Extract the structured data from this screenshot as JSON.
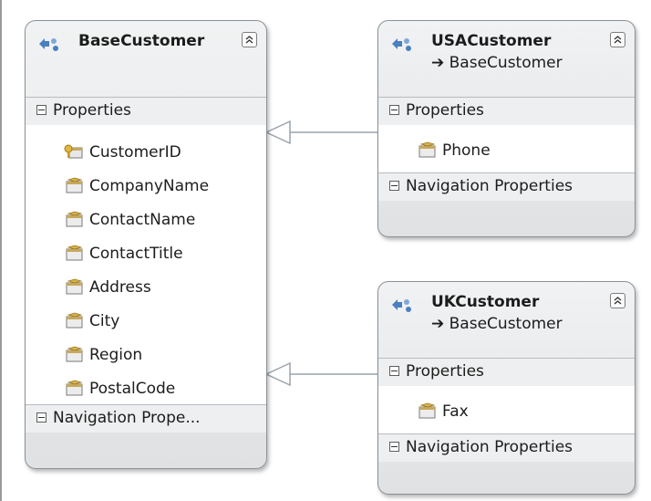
{
  "entities": {
    "base_customer": {
      "name": "BaseCustomer",
      "sections": {
        "properties": "Properties",
        "navigation": "Navigation  Prope..."
      },
      "properties": [
        "CustomerID",
        "CompanyName",
        "ContactName",
        "ContactTitle",
        "Address",
        "City",
        "Region",
        "PostalCode"
      ],
      "property_icons": [
        "key-property-icon",
        "property-icon",
        "property-icon",
        "property-icon",
        "property-icon",
        "property-icon",
        "property-icon",
        "property-icon"
      ]
    },
    "usa_customer": {
      "name": "USACustomer",
      "base": "➔ BaseCustomer",
      "sections": {
        "properties": "Properties",
        "navigation": "Navigation Properties"
      },
      "properties": [
        "Phone"
      ],
      "property_icons": [
        "property-icon"
      ]
    },
    "uk_customer": {
      "name": "UKCustomer",
      "base": "➔ BaseCustomer",
      "sections": {
        "properties": "Properties",
        "navigation": "Navigation Properties"
      },
      "properties": [
        "Fax"
      ],
      "property_icons": [
        "property-icon"
      ]
    }
  },
  "connectors": [
    {
      "from": "USACustomer",
      "to": "BaseCustomer",
      "type": "inheritance"
    },
    {
      "from": "UKCustomer",
      "to": "BaseCustomer",
      "type": "inheritance"
    }
  ],
  "colors": {
    "border": "#8c9196",
    "header": "#e4e6e8",
    "section": "#eeeff0",
    "connector": "#9ba3ab"
  }
}
